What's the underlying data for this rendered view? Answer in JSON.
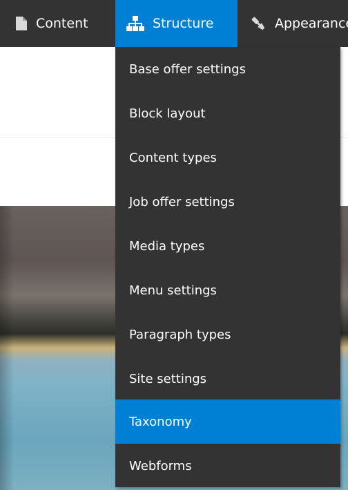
{
  "toolbar": {
    "tabs": [
      {
        "label": "Content",
        "icon": "file-icon"
      },
      {
        "label": "Structure",
        "icon": "sitemap-icon"
      },
      {
        "label": "Appearance",
        "icon": "paintbrush-icon"
      }
    ]
  },
  "structure_menu": {
    "items": [
      {
        "label": "Base offer settings"
      },
      {
        "label": "Block layout"
      },
      {
        "label": "Content types"
      },
      {
        "label": "Job offer settings"
      },
      {
        "label": "Media types"
      },
      {
        "label": "Menu settings"
      },
      {
        "label": "Paragraph types"
      },
      {
        "label": "Site settings"
      },
      {
        "label": "Taxonomy"
      },
      {
        "label": "Webforms"
      }
    ]
  },
  "colors": {
    "toolbar_bg": "#333333",
    "active_blue": "#0080d5"
  }
}
